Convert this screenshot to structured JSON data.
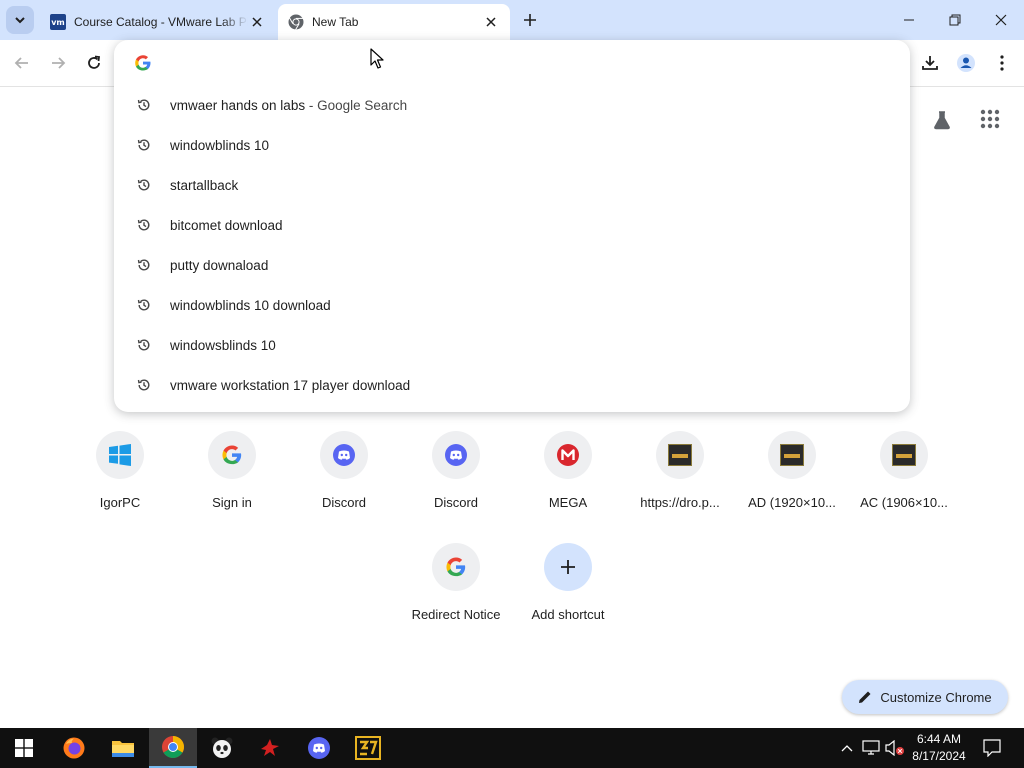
{
  "tabs": [
    {
      "title": "Course Catalog - VMware Lab Platform",
      "favicon": "vmware-icon",
      "active": false
    },
    {
      "title": "New Tab",
      "favicon": "chrome-icon",
      "active": true
    }
  ],
  "vm_favicon_text": "vm",
  "omnibox": {
    "value": "",
    "suggestions": [
      {
        "text": "vmwaer hands on labs",
        "suffix": " - Google Search"
      },
      {
        "text": "windowblinds 10",
        "suffix": ""
      },
      {
        "text": "startallback",
        "suffix": ""
      },
      {
        "text": "bitcomet download",
        "suffix": ""
      },
      {
        "text": "putty downaload",
        "suffix": ""
      },
      {
        "text": "windowblinds 10 download",
        "suffix": ""
      },
      {
        "text": "windowsblinds 10",
        "suffix": ""
      },
      {
        "text": "vmware workstation 17 player download",
        "suffix": ""
      }
    ]
  },
  "shortcuts": [
    {
      "label": "IgorPC",
      "icon": "windows-icon"
    },
    {
      "label": "Sign in",
      "icon": "google-icon"
    },
    {
      "label": "Discord",
      "icon": "discord-icon"
    },
    {
      "label": "Discord",
      "icon": "discord-icon"
    },
    {
      "label": "MEGA",
      "icon": "mega-icon"
    },
    {
      "label": "https://dro.p...",
      "icon": "thumbnail-icon"
    },
    {
      "label": "AD (1920×10...",
      "icon": "thumbnail-icon"
    },
    {
      "label": "AC (1906×10...",
      "icon": "thumbnail-icon"
    },
    {
      "label": "Redirect Notice",
      "icon": "google-icon"
    },
    {
      "label": "Add shortcut",
      "icon": "plus-icon"
    }
  ],
  "customize_label": "Customize Chrome",
  "clock": {
    "time": "6:44 AM",
    "date": "8/17/2024"
  },
  "colors": {
    "tabstrip": "#d3e3fd",
    "taskbar": "#101010",
    "accent": "#1a73e8"
  }
}
